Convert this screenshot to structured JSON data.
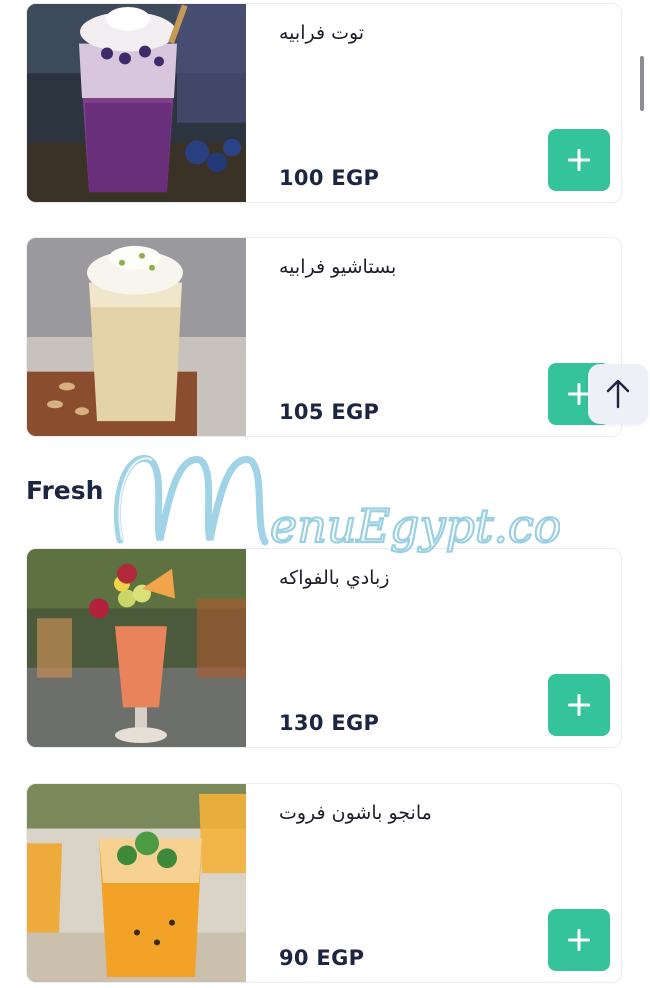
{
  "items_top": [
    {
      "name": "توت فرابيه",
      "price": "100 EGP",
      "add_label": "+"
    },
    {
      "name": "بستاشيو فرابيه",
      "price": "105 EGP",
      "add_label": "+"
    }
  ],
  "section": {
    "title": "Fresh"
  },
  "items_fresh": [
    {
      "name": "زبادي بالفواكه",
      "price": "130 EGP",
      "add_label": "+"
    },
    {
      "name": "مانجو باشون فروت",
      "price": "90 EGP",
      "add_label": "+"
    }
  ],
  "watermark": {
    "text": "MenuEgypt.com"
  },
  "colors": {
    "accent": "#34c39a",
    "price_text": "#1c2541",
    "watermark": "#8fcbe0"
  },
  "icons": {
    "add": "plus-icon",
    "scroll_top": "arrow-up-icon"
  }
}
